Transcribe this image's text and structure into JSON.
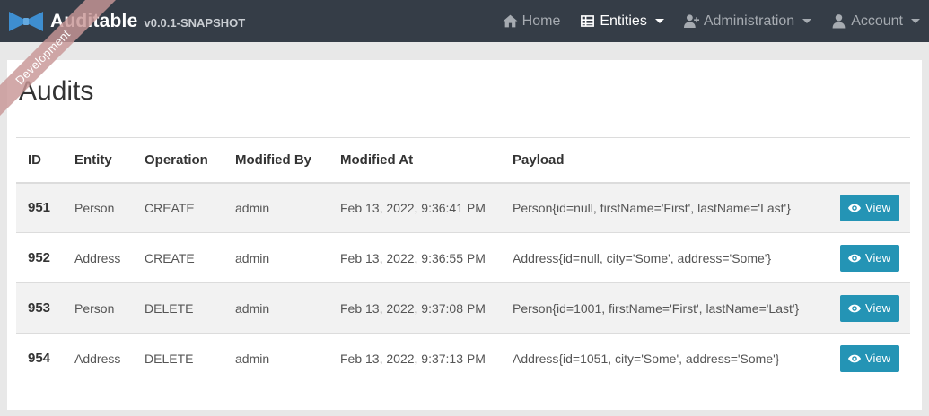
{
  "app": {
    "title": "Auditable",
    "version": "v0.0.1-SNAPSHOT",
    "ribbon": "Development"
  },
  "nav": {
    "items": [
      {
        "label": "Home",
        "icon": "home-icon",
        "active": false,
        "dropdown": false
      },
      {
        "label": "Entities",
        "icon": "table-icon",
        "active": true,
        "dropdown": true
      },
      {
        "label": "Administration",
        "icon": "user-plus-icon",
        "active": false,
        "dropdown": true
      },
      {
        "label": "Account",
        "icon": "user-icon",
        "active": false,
        "dropdown": true
      }
    ]
  },
  "page": {
    "title": "Audits"
  },
  "table": {
    "columns": [
      "ID",
      "Entity",
      "Operation",
      "Modified By",
      "Modified At",
      "Payload",
      ""
    ],
    "rows": [
      {
        "id": "951",
        "entity": "Person",
        "operation": "CREATE",
        "modified_by": "admin",
        "modified_at": "Feb 13, 2022, 9:36:41 PM",
        "payload": "Person{id=null, firstName='First', lastName='Last'}",
        "action": "View"
      },
      {
        "id": "952",
        "entity": "Address",
        "operation": "CREATE",
        "modified_by": "admin",
        "modified_at": "Feb 13, 2022, 9:36:55 PM",
        "payload": "Address{id=null, city='Some', address='Some'}",
        "action": "View"
      },
      {
        "id": "953",
        "entity": "Person",
        "operation": "DELETE",
        "modified_by": "admin",
        "modified_at": "Feb 13, 2022, 9:37:08 PM",
        "payload": "Person{id=1001, firstName='First', lastName='Last'}",
        "action": "View"
      },
      {
        "id": "954",
        "entity": "Address",
        "operation": "DELETE",
        "modified_by": "admin",
        "modified_at": "Feb 13, 2022, 9:37:13 PM",
        "payload": "Address{id=1051, city='Some', address='Some'}",
        "action": "View"
      }
    ]
  },
  "colors": {
    "navbar": "#353d47",
    "accent": "#2494b5",
    "logo": "#3e8ed0",
    "ribbon": "#c89696",
    "row_stripe": "#f2f2f2"
  }
}
